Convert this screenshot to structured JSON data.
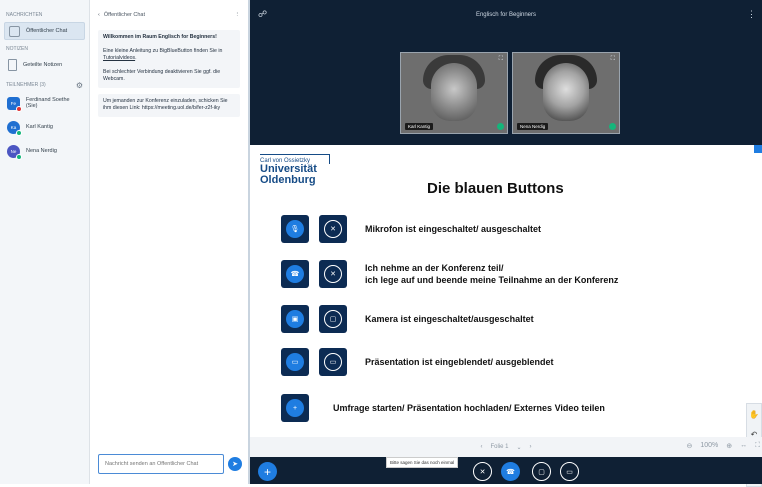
{
  "sidebar": {
    "messages_header": "NACHRICHTEN",
    "public_chat": "Öffentlicher Chat",
    "notes_header": "NOTIZEN",
    "shared_notes": "Geteilte Notizen",
    "users_header": "TEILNEHMER (3)",
    "users": [
      {
        "name": "Ferdinand Soethe (Sie)",
        "initials": "Fe",
        "color": "#1f6fd1"
      },
      {
        "name": "Karl Kantig",
        "initials": "Ka",
        "color": "#1f6fd1"
      },
      {
        "name": "Nena Nerdig",
        "initials": "Ne",
        "color": "#4b56c2"
      }
    ]
  },
  "chat": {
    "title": "Öffentlicher Chat",
    "message1_line1": "Willkommen im Raum Englisch for Beginners!",
    "message1_line2": "Eine kleine Anleitung zu BigBlueButton finden Sie in",
    "message1_link": "Tutorialvideos",
    "message1_line3": "Bei schlechter Verbindung deaktivieren Sie ggf. die Webcam.",
    "message2": "Um jemanden zur Konferenz einzuladen, schicken Sie ihm diesen Link: https://meeting.uol.de/b/fer-z2f-iky",
    "input_placeholder": "Nachricht senden an Öffentlicher Chat"
  },
  "main": {
    "title": "Englisch for Beginners"
  },
  "videos": [
    {
      "label": "Karl Kantig"
    },
    {
      "label": "Nena Nerdig"
    }
  ],
  "slide": {
    "logo_small": "Carl von Ossietzky",
    "logo_line1": "Universität",
    "logo_line2": "Oldenburg",
    "title": "Die blauen Buttons",
    "rows": [
      {
        "text": "Mikrofon ist eingeschaltet/ ausgeschaltet"
      },
      {
        "text1": "Ich nehme an der Konferenz teil/",
        "text2": "ich lege auf und beende meine Teilnahme an der Konferenz"
      },
      {
        "text": "Kamera ist eingeschaltet/ausgeschaltet"
      },
      {
        "text": "Präsentation ist eingeblendet/  ausgeblendet"
      },
      {
        "text": "Umfrage starten/ Präsentation hochladen/ Externes Video teilen"
      }
    ],
    "footer_page": "Folie 1",
    "footer_zoom": "100%"
  },
  "bottom": {
    "tooltip": "Bitte sagen Sie das noch einmal"
  },
  "colors": {
    "accent": "#1f7de1",
    "dark_bg": "#0f2034",
    "slide_button": "#0c2b53"
  }
}
